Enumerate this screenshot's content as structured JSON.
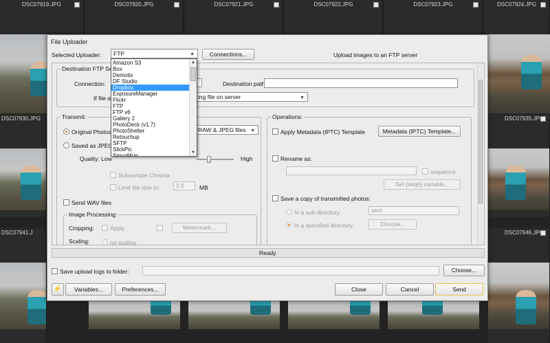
{
  "thumbnails": {
    "row1": [
      "DSC07919.JPG",
      "DSC07920.JPG",
      "DSC07921.JPG",
      "DSC07922.JPG",
      "DSC07923.JPG",
      "DSC07924.JPG"
    ],
    "row2_left": "DSC07930.JPG",
    "row2_right": "DSC07935.JPG",
    "row3_left": "DSC07941.J",
    "row3_right": "DSC07946.JPG"
  },
  "dialog": {
    "title": "File Uploader",
    "selected_uploader_label": "Selected Uploader:",
    "selected_uploader_value": "FTP",
    "connections_button": "Connections...",
    "upload_description": "Upload images to an FTP server",
    "dropdown_options": [
      "Amazon S3",
      "Box",
      "Demotix",
      "DF Studio",
      "Dropbox",
      "ExposureManager",
      "Flickr",
      "FTP",
      "FTP v6",
      "Gallery 2",
      "PhotoDeck (v1.7)",
      "PhotoShelter",
      "Retouchup",
      "SFTP",
      "SlickPic",
      "SmugMug"
    ],
    "dropdown_highlighted": "Dropbox",
    "destination": {
      "group_title": "Destination FTP Serv",
      "connection_label": "Connection:",
      "destination_path_label": "Destination path:",
      "if_file_label": "If file al",
      "if_file_value": "ing file on server"
    },
    "transmit": {
      "group_title": "Transmit:",
      "original_photos": "Original Photos",
      "original_photos_value": "RAW & JPEG files",
      "saved_as_jpeg": "Saved as JPEG",
      "quality_label": "Quality: Low",
      "quality_high": "High",
      "subsample_chroma": "Subsample Chroma",
      "limit_file_size": "Limit file size to:",
      "limit_value": "2.0",
      "limit_unit": "MB",
      "send_wav": "Send WAV files",
      "image_processing": {
        "title": "Image Processing:",
        "cropping": "Cropping:",
        "apply": "Apply",
        "watermark": "Watermark...",
        "scaling": "Scaling:",
        "no_scaling": "no scaling"
      }
    },
    "operations": {
      "group_title": "Operations:",
      "apply_metadata": "Apply Metadata (IPTC) Template",
      "metadata_button": "Metadata (IPTC) Template...",
      "rename_as": "Rename as:",
      "sequence": "sequence",
      "set_seqn": "Set {seqn} variable...",
      "save_copy": "Save a copy of transmitted photos:",
      "in_sub_directory": "In a sub-directory:",
      "sub_directory_value": "sent",
      "in_specified_directory": "In a specified directory:",
      "choose": "Choose..."
    },
    "status": "Ready.",
    "save_logs_label": "Save upload logs to folder:",
    "choose_logs_button": "Choose...",
    "variables_button": "Variables...",
    "preferences_button": "Preferences...",
    "close_button": "Close",
    "cancel_button": "Cancel",
    "send_button": "Send"
  },
  "icons": {
    "lightning": "⚡"
  }
}
